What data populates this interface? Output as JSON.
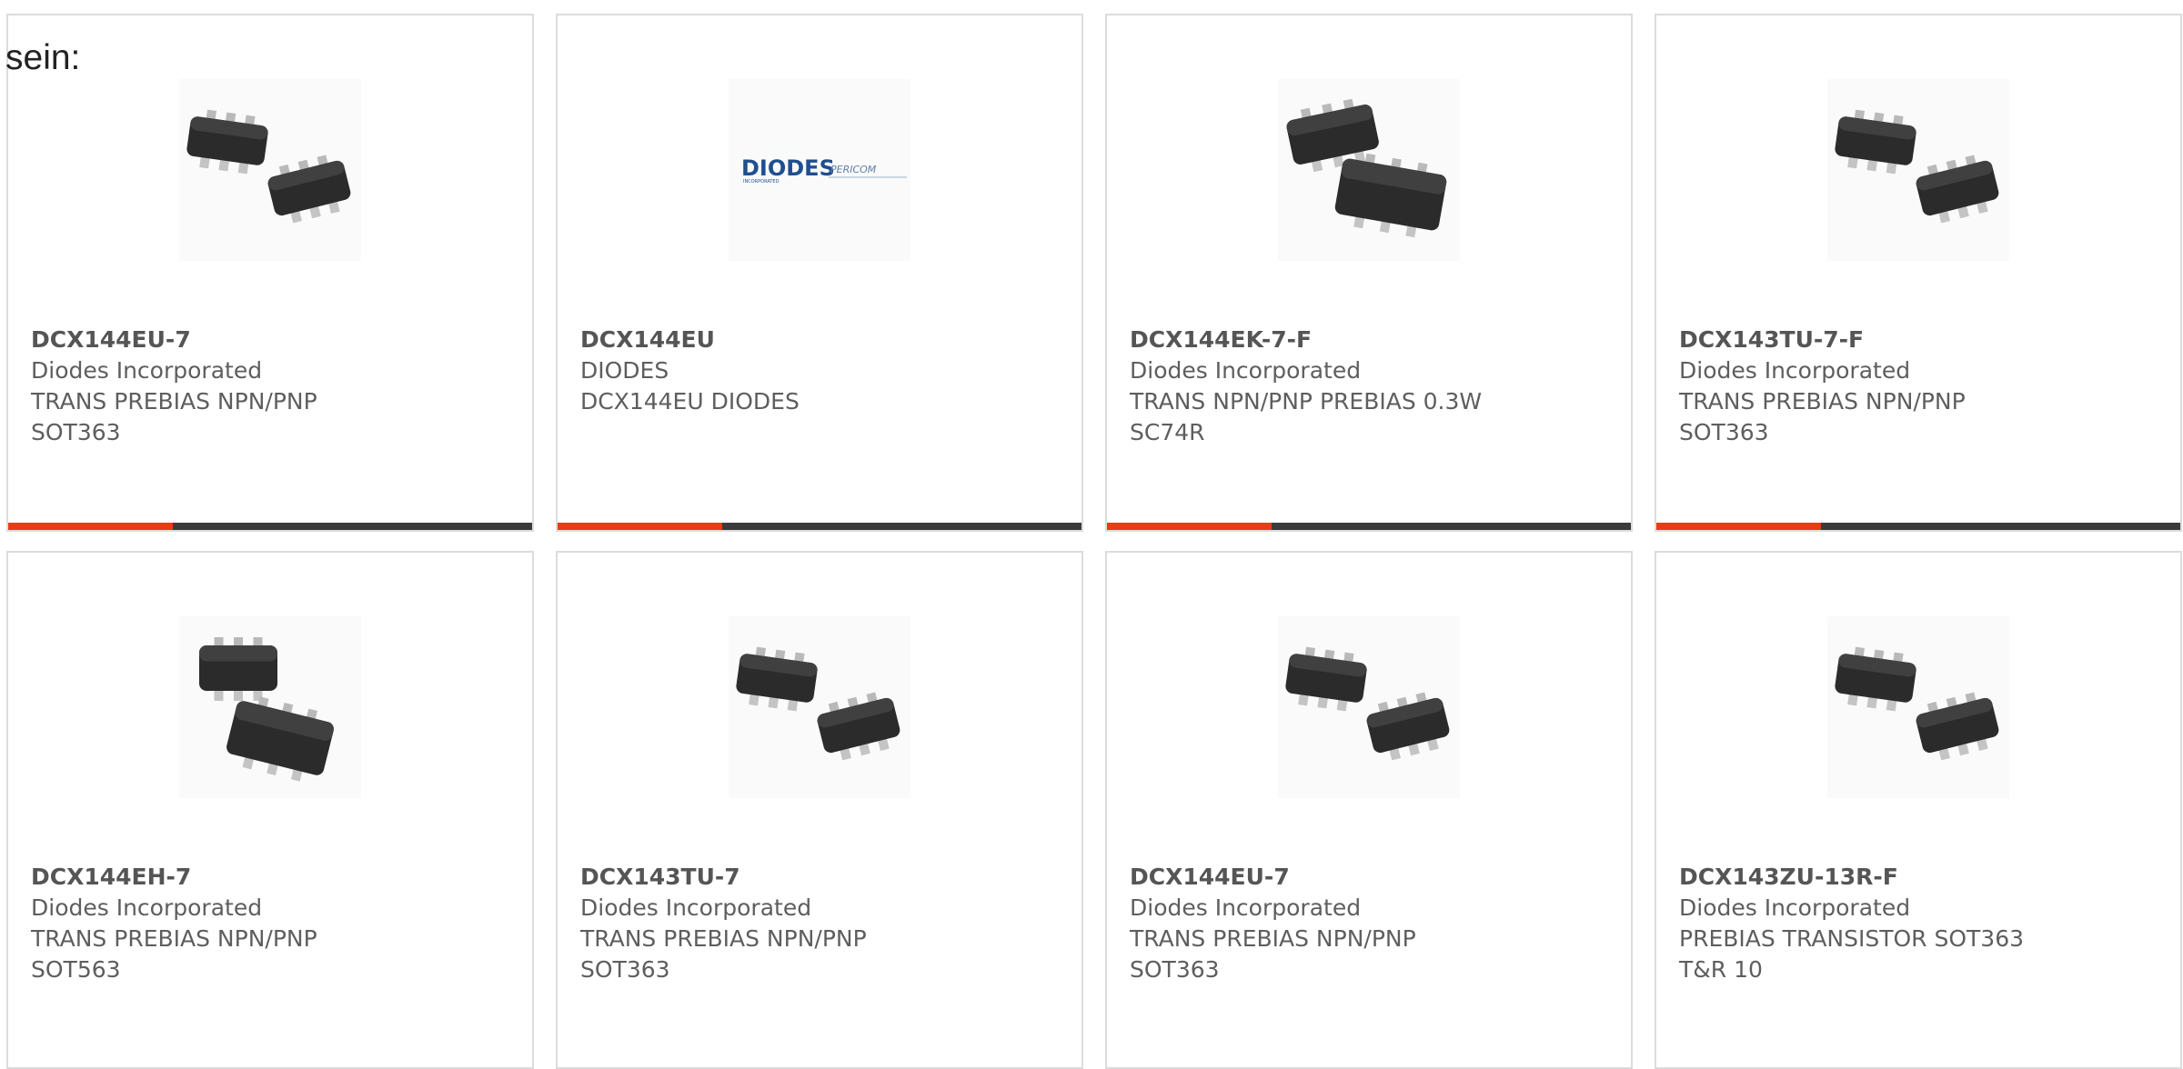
{
  "heading": "sein:",
  "colors": {
    "accent": "#ee3a14",
    "bar": "#3b3b3b",
    "border": "#dcdcdc",
    "text": "#5e5e5e"
  },
  "products": [
    {
      "part": "DCX144EU-7",
      "maker": "Diodes Incorporated",
      "desc1": "TRANS PREBIAS NPN/PNP",
      "desc2": "SOT363",
      "image": "sot363-chip-pair"
    },
    {
      "part": "DCX144EU",
      "maker": "DIODES",
      "desc1": "DCX144EU DIODES",
      "desc2": "",
      "image": "diodes-pericom-logo",
      "logo_text": "DIODES",
      "logo_sub": "INCORPORATED",
      "logo_text2": "PERICOM"
    },
    {
      "part": "DCX144EK-7-F",
      "maker": "Diodes Incorporated",
      "desc1": "TRANS NPN/PNP PREBIAS 0.3W",
      "desc2": "SC74R",
      "image": "sc74r-chip-pair"
    },
    {
      "part": "DCX143TU-7-F",
      "maker": "Diodes Incorporated",
      "desc1": "TRANS PREBIAS NPN/PNP",
      "desc2": "SOT363",
      "image": "sot363-chip-pair"
    },
    {
      "part": "DCX144EH-7",
      "maker": "Diodes Incorporated",
      "desc1": "TRANS PREBIAS NPN/PNP",
      "desc2": "SOT563",
      "image": "sot563-chip-pair"
    },
    {
      "part": "DCX143TU-7",
      "maker": "Diodes Incorporated",
      "desc1": "TRANS PREBIAS NPN/PNP",
      "desc2": "SOT363",
      "image": "sot363-chip-pair"
    },
    {
      "part": "DCX144EU-7",
      "maker": "Diodes Incorporated",
      "desc1": "TRANS PREBIAS NPN/PNP",
      "desc2": "SOT363",
      "image": "sot363-chip-pair"
    },
    {
      "part": "DCX143ZU-13R-F",
      "maker": "Diodes Incorporated",
      "desc1": "PREBIAS TRANSISTOR SOT363",
      "desc2": "T&R 10",
      "image": "sot363-chip-pair"
    }
  ]
}
